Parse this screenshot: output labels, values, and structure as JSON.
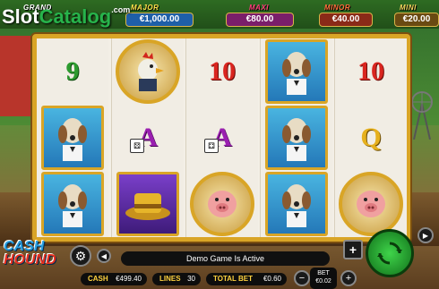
{
  "logo": {
    "text_main": "Slot",
    "text_accent": "Catalog",
    "suffix": ".com"
  },
  "jackpots": [
    {
      "label": "GRAND",
      "value": ""
    },
    {
      "label": "MAJOR",
      "value": "€1,000.00"
    },
    {
      "label": "MAXI",
      "value": "€80.00"
    },
    {
      "label": "MINOR",
      "value": "€40.00"
    },
    {
      "label": "MINI",
      "value": "€20.00"
    }
  ],
  "reels": [
    [
      "9",
      "dog-butler",
      "dog-butler"
    ],
    [
      "rooster",
      "A",
      "gold-hat"
    ],
    [
      "10",
      "A",
      "pig"
    ],
    [
      "dog-butler",
      "dog-butler",
      "dog-butler"
    ],
    [
      "10",
      "Q",
      "pig"
    ]
  ],
  "brand": {
    "line1": "CASH",
    "line2": "HOUND"
  },
  "message": "Demo Game Is Active",
  "footer": {
    "cash_label": "CASH",
    "cash_value": "€499.40",
    "lines_label": "LINES",
    "lines_value": "30",
    "total_bet_label": "TOTAL BET",
    "total_bet_value": "€0.60",
    "bet_label": "BET",
    "bet_value": "€0.02"
  },
  "icons": {
    "settings": "gear-icon",
    "sound": "speaker-icon",
    "plus": "plus-icon",
    "minus": "minus-icon",
    "spin": "spin-arrows-icon",
    "autoplay": "play-icon"
  },
  "colors": {
    "frame_gold": "#d9a526",
    "spin_green": "#3fd44a"
  }
}
